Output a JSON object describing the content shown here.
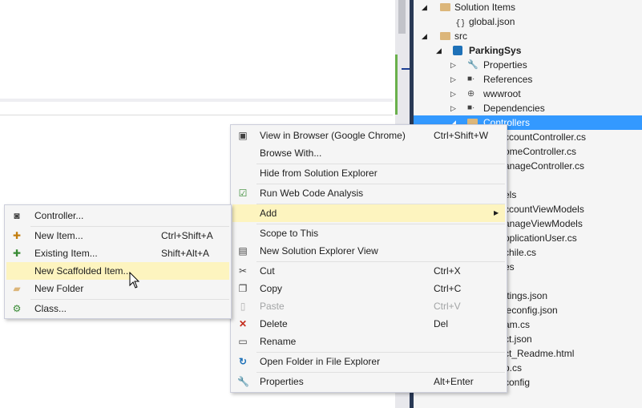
{
  "tree": {
    "items": [
      {
        "label": "Solution Items",
        "arrow": "◢",
        "icon": "folder-icon"
      },
      {
        "label": "global.json",
        "arrow": "",
        "icon": "json-file-icon"
      },
      {
        "label": "src",
        "arrow": "◢",
        "icon": "folder-icon"
      },
      {
        "label": "ParkingSys",
        "arrow": "◢",
        "icon": "web-project-icon"
      },
      {
        "label": "Properties",
        "arrow": "▷",
        "icon": "wrench-icon"
      },
      {
        "label": "References",
        "arrow": "▷",
        "icon": "references-icon"
      },
      {
        "label": "wwwroot",
        "arrow": "▷",
        "icon": "globe-icon"
      },
      {
        "label": "Dependencies",
        "arrow": "▷",
        "icon": "dependencies-icon"
      },
      {
        "label": "Controllers",
        "arrow": "◢",
        "icon": "folder-icon"
      },
      {
        "label": "ccountController.cs"
      },
      {
        "label": "omeController.cs"
      },
      {
        "label": "anageController.cs"
      },
      {
        "label": ""
      },
      {
        "label": "els"
      },
      {
        "label": "ccountViewModels"
      },
      {
        "label": "anageViewModels"
      },
      {
        "label": "pplicationUser.cs"
      },
      {
        "label": "chile.cs"
      },
      {
        "label": "es"
      },
      {
        "label": ""
      },
      {
        "label": "ttings.json"
      },
      {
        "label": "leconfig.json"
      },
      {
        "label": "am.cs"
      },
      {
        "label": "ct.json"
      },
      {
        "label": "ct_Readme.html"
      },
      {
        "label": "p.cs"
      },
      {
        "label": "config"
      }
    ]
  },
  "context_menu": {
    "items": [
      {
        "label": "View in Browser (Google Chrome)",
        "shortcut": "Ctrl+Shift+W",
        "icon": "browser-icon"
      },
      {
        "label": "Browse With...",
        "shortcut": "",
        "icon": ""
      },
      {
        "label": "Hide from Solution Explorer",
        "shortcut": "",
        "icon": ""
      },
      {
        "label": "Run Web Code Analysis",
        "shortcut": "",
        "icon": "code-analysis-icon"
      },
      {
        "label": "Add",
        "shortcut": "",
        "icon": "",
        "submenu_arrow": "▶"
      },
      {
        "label": "Scope to This",
        "shortcut": "",
        "icon": ""
      },
      {
        "label": "New Solution Explorer View",
        "shortcut": "",
        "icon": "new-view-icon"
      },
      {
        "label": "Cut",
        "shortcut": "Ctrl+X",
        "icon": "scissors-icon"
      },
      {
        "label": "Copy",
        "shortcut": "Ctrl+C",
        "icon": "copy-icon"
      },
      {
        "label": "Paste",
        "shortcut": "Ctrl+V",
        "icon": "paste-icon"
      },
      {
        "label": "Delete",
        "shortcut": "Del",
        "icon": "delete-icon"
      },
      {
        "label": "Rename",
        "shortcut": "",
        "icon": "rename-icon"
      },
      {
        "label": "Open Folder in File Explorer",
        "shortcut": "",
        "icon": "refresh-arrow-icon"
      },
      {
        "label": "Properties",
        "shortcut": "Alt+Enter",
        "icon": "wrench-icon"
      }
    ]
  },
  "add_submenu": {
    "items": [
      {
        "label": "Controller...",
        "shortcut": "",
        "icon": "controller-icon"
      },
      {
        "label": "New Item...",
        "shortcut": "Ctrl+Shift+A",
        "icon": "new-item-icon"
      },
      {
        "label": "Existing Item...",
        "shortcut": "Shift+Alt+A",
        "icon": "existing-item-icon"
      },
      {
        "label": "New Scaffolded Item...",
        "shortcut": "",
        "icon": ""
      },
      {
        "label": "New Folder",
        "shortcut": "",
        "icon": "new-folder-icon"
      },
      {
        "label": "Class...",
        "shortcut": "",
        "icon": "class-icon"
      }
    ]
  },
  "colors": {
    "selection": "#3399ff",
    "hover": "#fdf4bf",
    "menu_bg": "#f5f5f5"
  }
}
